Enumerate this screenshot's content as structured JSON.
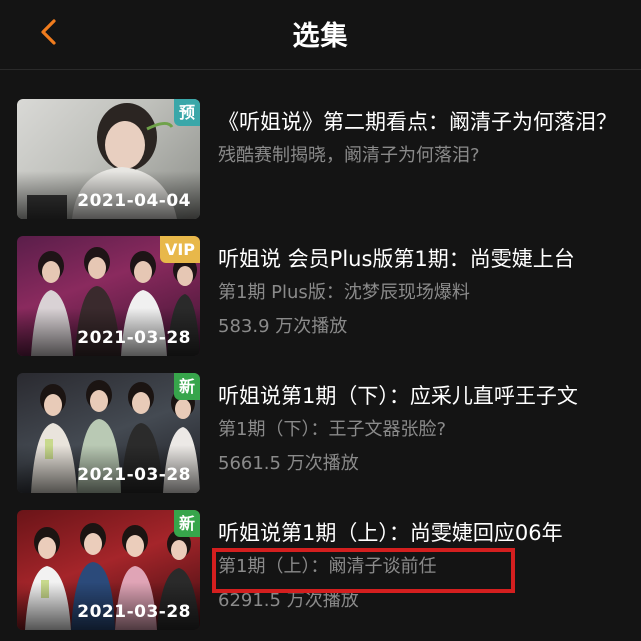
{
  "header": {
    "title": "选集",
    "back_icon": "chevron-left-icon",
    "accent_color": "#f07c1e"
  },
  "episodes": [
    {
      "date": "2021-04-04",
      "badge": "预",
      "badge_color": "#3aa7a9",
      "title": "《听姐说》第二期看点：阚清子为何落泪？",
      "subtitle": "残酷赛制揭晓，阚清子为何落泪?",
      "plays": ""
    },
    {
      "date": "2021-03-28",
      "badge": "VIP",
      "badge_color": "#e8b84a",
      "title": "听姐说 会员Plus版第1期：尚雯婕上台",
      "subtitle": "第1期 Plus版：沈梦辰现场爆料",
      "plays": "583.9 万次播放"
    },
    {
      "date": "2021-03-28",
      "badge": "新",
      "badge_color": "#37a54b",
      "title": "听姐说第1期（下）：应采儿直呼王子文",
      "subtitle": "第1期（下）：王子文器张脸?",
      "plays": "5661.5 万次播放"
    },
    {
      "date": "2021-03-28",
      "badge": "新",
      "badge_color": "#37a54b",
      "title": "听姐说第1期（上）：尚雯婕回应06年",
      "subtitle": "第1期（上）：阚清子谈前任",
      "plays": "6291.5 万次播放"
    }
  ],
  "highlight_color": "#d41f1f"
}
